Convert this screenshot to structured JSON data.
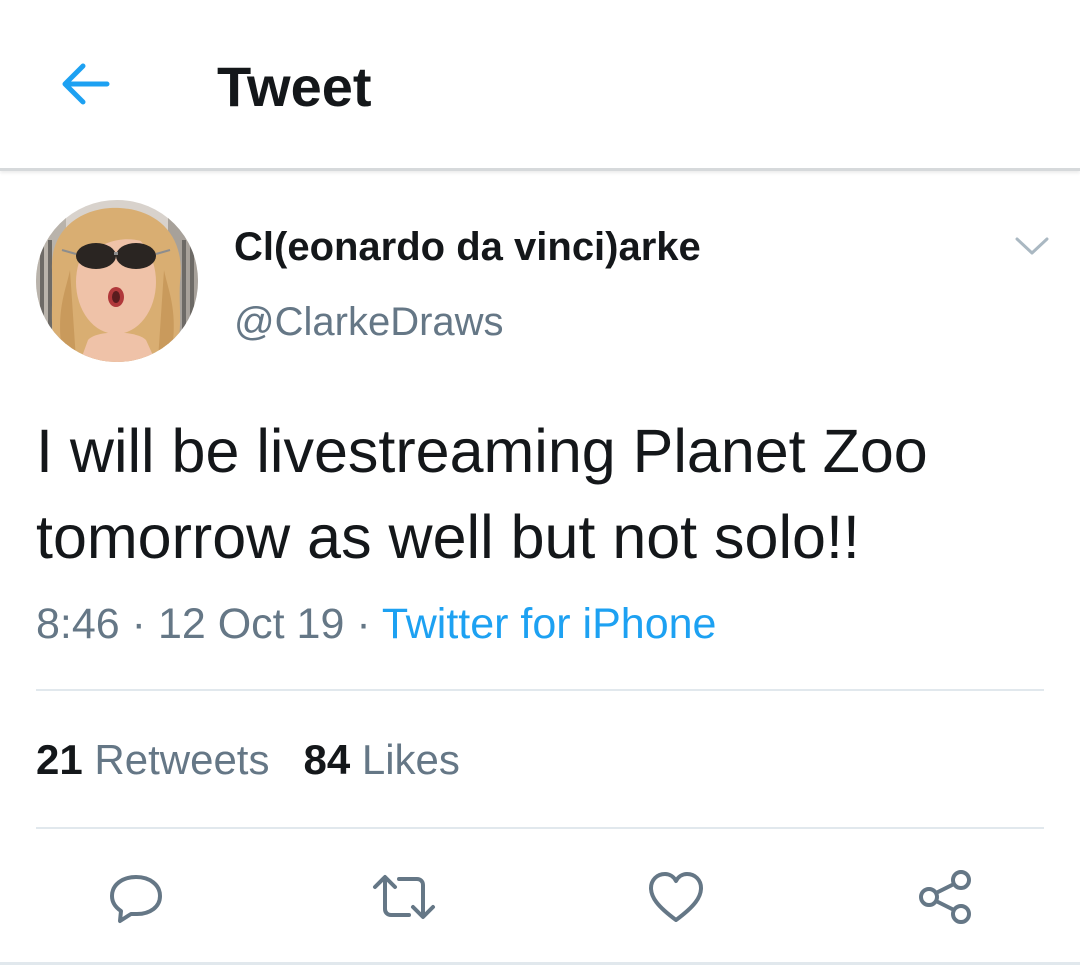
{
  "header": {
    "title": "Tweet",
    "back_icon": "arrow-left-icon",
    "accent_color": "#1da1f2"
  },
  "tweet": {
    "display_name": "Cl(eonardo da vinci)arke",
    "handle": "@ClarkeDraws",
    "text": "I will be livestreaming Planet Zoo tomorrow as well but not solo!!",
    "time": "8:46",
    "date": "12 Oct 19",
    "source": "Twitter for iPhone",
    "separator": "·",
    "retweets_count": "21",
    "retweets_label": "Retweets",
    "likes_count": "84",
    "likes_label": "Likes"
  },
  "actions": {
    "reply": "reply-icon",
    "retweet": "retweet-icon",
    "like": "heart-icon",
    "share": "share-icon"
  },
  "colors": {
    "text_primary": "#14171a",
    "text_secondary": "#657786",
    "link": "#1da1f2",
    "divider": "#e1e8ed"
  }
}
